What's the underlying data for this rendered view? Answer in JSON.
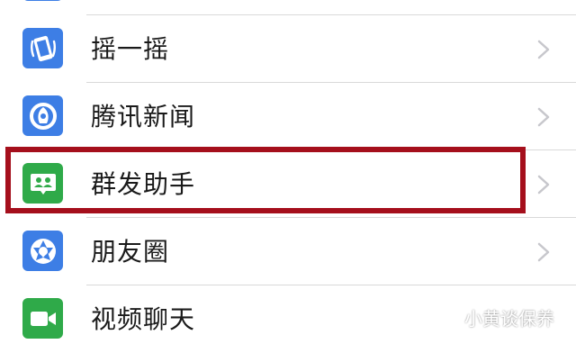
{
  "menu": {
    "items": [
      {
        "label": "",
        "icon": "app-icon",
        "color": "#3d7ee5"
      },
      {
        "label": "摇一摇",
        "icon": "shake-icon",
        "color": "#3d7ee5"
      },
      {
        "label": "腾讯新闻",
        "icon": "news-icon",
        "color": "#3d7ee5"
      },
      {
        "label": "群发助手",
        "icon": "broadcast-icon",
        "color": "#2faa49"
      },
      {
        "label": "朋友圈",
        "icon": "moments-icon",
        "color": "#3d7ee5"
      },
      {
        "label": "视频聊天",
        "icon": "video-call-icon",
        "color": "#2faa49"
      }
    ]
  },
  "highlight": {
    "color": "#a50f1c",
    "target": "群发助手"
  },
  "watermark": {
    "text": "小黄谈保养"
  }
}
